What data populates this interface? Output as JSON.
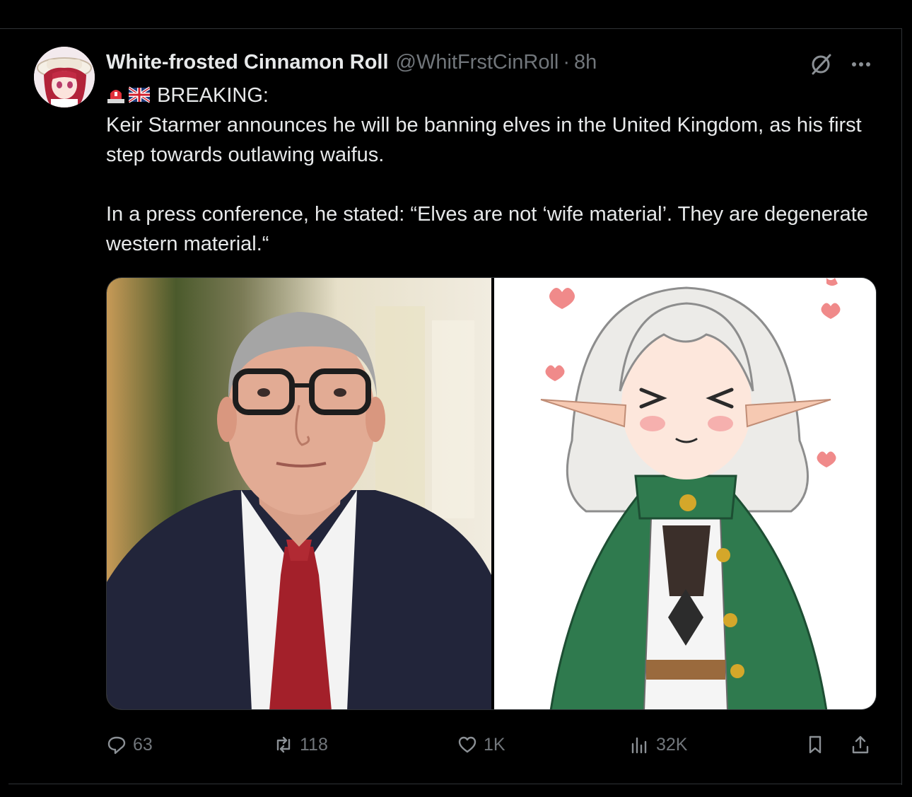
{
  "post": {
    "author": {
      "display_name": "White-frosted Cinnamon Roll",
      "handle": "@WhitFrstCinRoll",
      "separator": "·",
      "time": "8h"
    },
    "headline": "BREAKING:",
    "paragraph_1": "Keir Starmer announces he will be banning elves in the United Kingdom, as his first step towards outlawing waifus.",
    "paragraph_2": "In a press conference, he stated: “Elves are not ‘wife material’. They are degenerate western material.“",
    "badges": [
      "rotating-light-icon",
      "uk-flag-icon"
    ],
    "header_icons": [
      "grok-icon",
      "more-icon"
    ]
  },
  "media": {
    "left_image": "man-in-suit-photo",
    "right_image": "anime-elf-girl-illustration"
  },
  "actions": {
    "replies": "63",
    "reposts": "118",
    "likes": "1K",
    "views": "32K",
    "icons": [
      "reply-icon",
      "repost-icon",
      "like-icon",
      "views-icon",
      "bookmark-icon",
      "share-icon"
    ]
  },
  "colors": {
    "background": "#000000",
    "text": "#e7e9ea",
    "secondary_text": "#71767b",
    "divider": "#2f3336"
  }
}
